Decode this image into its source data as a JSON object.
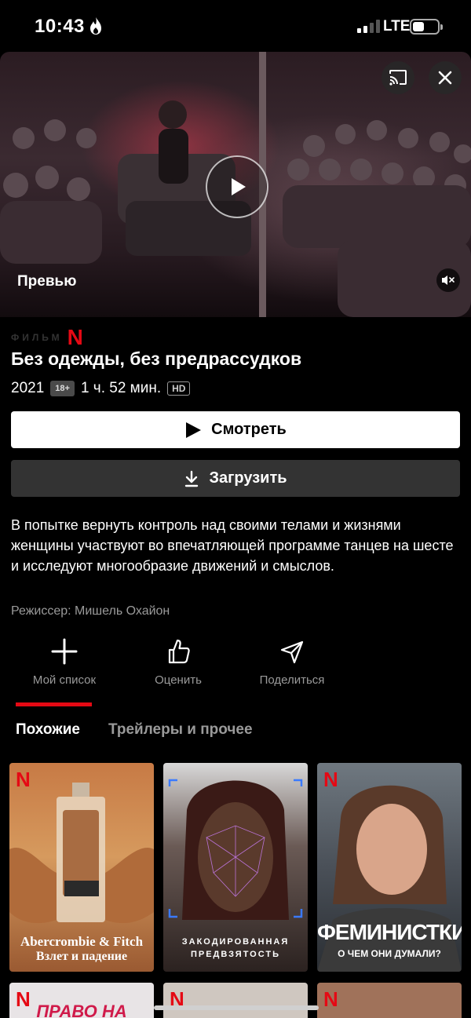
{
  "status_bar": {
    "time": "10:43",
    "network": "LTE",
    "signal_bars": 2,
    "battery_level": 0.35
  },
  "hero": {
    "preview_label": "Превью"
  },
  "info": {
    "type_label": "ФИЛЬМ",
    "netflix_logo": "N",
    "title": "Без одежды, без предрассудков",
    "year": "2021",
    "age_rating": "18+",
    "duration": "1 ч. 52 мин.",
    "quality": "HD"
  },
  "buttons": {
    "play_label": "Смотреть",
    "download_label": "Загрузить"
  },
  "description": "В попытке вернуть контроль над своими телами и жизнями женщины участвуют во впечатляющей программе танцев на шесте и исследуют многообразие движений и смыслов.",
  "director": "Режиссер: Мишель Охайон",
  "actions": [
    {
      "label": "Мой список",
      "icon": "plus-icon"
    },
    {
      "label": "Оценить",
      "icon": "thumbs-up-icon"
    },
    {
      "label": "Поделиться",
      "icon": "send-icon"
    }
  ],
  "tabs": [
    {
      "label": "Похожие",
      "active": true
    },
    {
      "label": "Трейлеры и прочее",
      "active": false
    }
  ],
  "similar": [
    {
      "caption_line1": "Abercrombie & Fitch",
      "caption_line2": "Взлет и падение",
      "badge": "N"
    },
    {
      "caption_line1": "ЗАКОДИРОВАННАЯ",
      "caption_line2": "ПРЕДВЗЯТОСТЬ",
      "badge": ""
    },
    {
      "caption_line1": "ФЕМИНИСТКИ",
      "caption_line2": "О ЧЕМ ОНИ ДУМАЛИ?",
      "badge": "N"
    },
    {
      "caption_line1": "ПРАВО НА ЖИЗНЬ",
      "caption_line2": "",
      "badge": "N"
    },
    {
      "caption_line1": "",
      "caption_line2": "",
      "badge": "N"
    },
    {
      "caption_line1": "",
      "caption_line2": "",
      "badge": "N"
    }
  ],
  "colors": {
    "accent": "#e50914",
    "background": "#000000",
    "muted_text": "#9a9a9a"
  }
}
